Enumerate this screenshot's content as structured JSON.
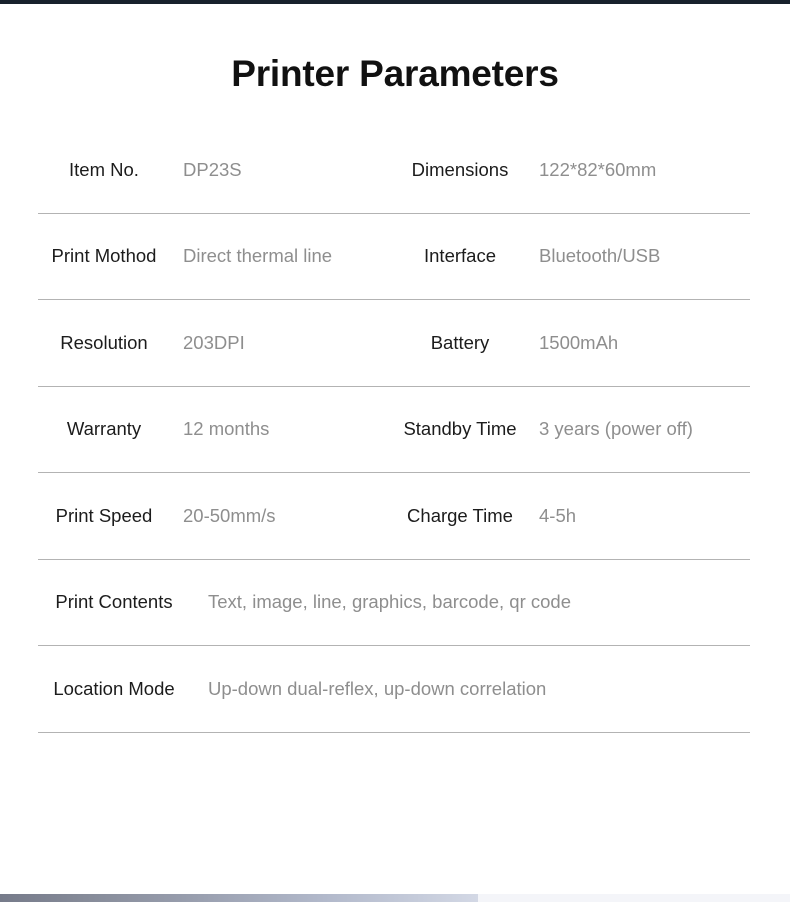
{
  "document": {
    "title": "Printer Parameters"
  },
  "theme": {
    "top_bar_color": "#18212c",
    "label_color": "#1c1c1c",
    "value_color": "#8e8e8e",
    "divider_color": "#b3b3b3"
  },
  "spec_rows": [
    {
      "layout": "two-column",
      "cells": [
        {
          "label": "Item No.",
          "value": "DP23S"
        },
        {
          "label": "Dimensions",
          "value": "122*82*60mm"
        }
      ]
    },
    {
      "layout": "two-column",
      "cells": [
        {
          "label": "Print Mothod",
          "value": "Direct thermal line"
        },
        {
          "label": "Interface",
          "value": "Bluetooth/USB"
        }
      ]
    },
    {
      "layout": "two-column",
      "cells": [
        {
          "label": "Resolution",
          "value": "203DPI"
        },
        {
          "label": "Battery",
          "value": "1500mAh"
        }
      ]
    },
    {
      "layout": "two-column",
      "cells": [
        {
          "label": "Warranty",
          "value": "12 months"
        },
        {
          "label": "Standby Time",
          "value": "3 years (power off)"
        }
      ]
    },
    {
      "layout": "two-column",
      "cells": [
        {
          "label": "Print Speed",
          "value": "20-50mm/s"
        },
        {
          "label": "Charge Time",
          "value": "4-5h"
        }
      ]
    },
    {
      "layout": "full-width",
      "cells": [
        {
          "label": "Print Contents",
          "value": "Text, image, line, graphics, barcode, qr code"
        }
      ]
    },
    {
      "layout": "full-width",
      "cells": [
        {
          "label": "Location Mode",
          "value": "Up-down dual-reflex, up-down correlation"
        }
      ]
    }
  ]
}
